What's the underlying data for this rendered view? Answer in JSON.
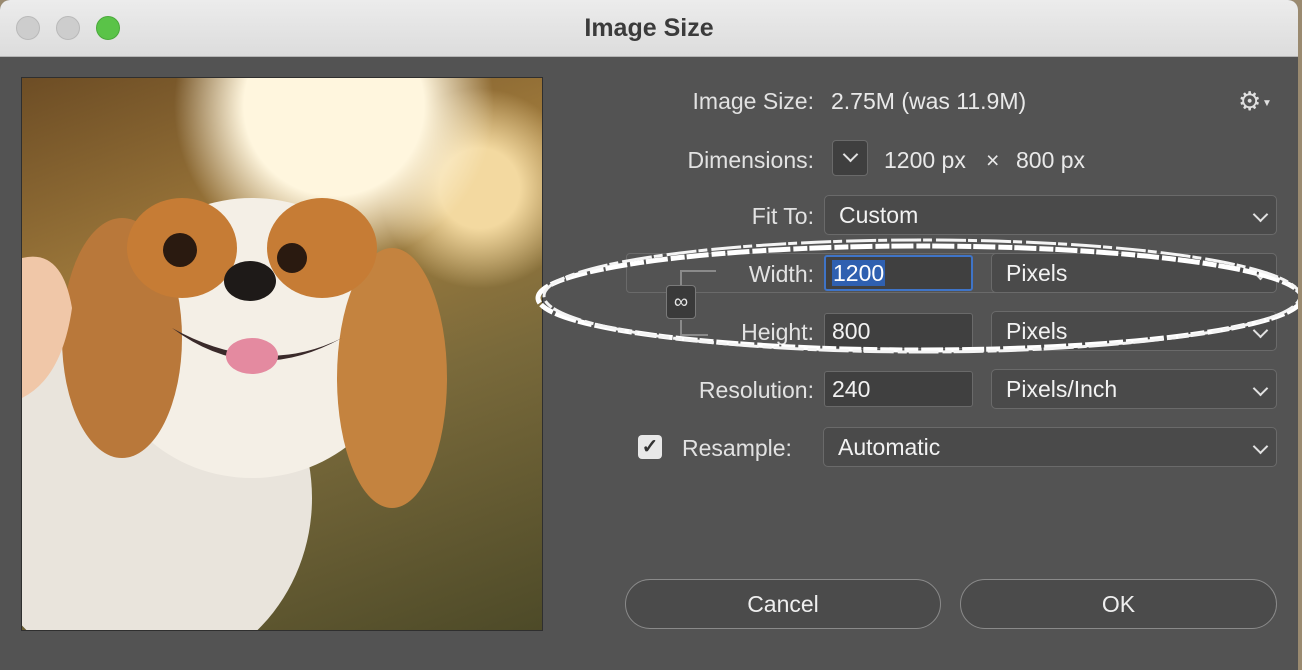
{
  "window": {
    "title": "Image Size"
  },
  "image_size": {
    "label": "Image Size:",
    "value": "2.75M (was 11.9M)"
  },
  "dimensions": {
    "label": "Dimensions:",
    "width": "1200 px",
    "times": "×",
    "height": "800 px"
  },
  "fit_to": {
    "label": "Fit To:",
    "selected": "Custom"
  },
  "width": {
    "label": "Width:",
    "value": "1200",
    "unit": "Pixels"
  },
  "height": {
    "label": "Height:",
    "value": "800",
    "unit": "Pixels"
  },
  "resolution": {
    "label": "Resolution:",
    "value": "240",
    "unit": "Pixels/Inch"
  },
  "resample": {
    "label": "Resample:",
    "checked": true,
    "selected": "Automatic"
  },
  "buttons": {
    "cancel": "Cancel",
    "ok": "OK"
  },
  "icons": {
    "gear": "gear-icon",
    "link": "chain-link-icon",
    "check": "checkmark-icon"
  },
  "colors": {
    "dialog_bg": "#535353",
    "focus": "#3f74c7",
    "traffic_green": "#5ac348"
  }
}
